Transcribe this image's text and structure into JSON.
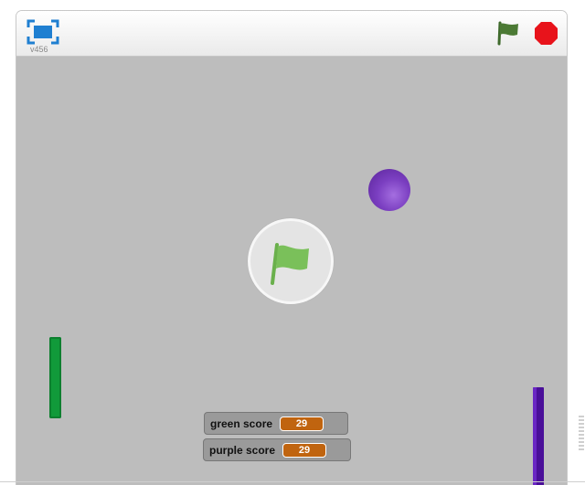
{
  "player": {
    "version_label": "v456"
  },
  "toolbar": {
    "fullscreen_icon": "fullscreen-icon",
    "green_flag_icon": "green-flag-icon",
    "stop_icon": "stop-icon"
  },
  "stage": {
    "background_color": "#bdbdbd",
    "start_overlay_icon": "green-flag-icon"
  },
  "monitors": [
    {
      "label": "green score",
      "value": "29"
    },
    {
      "label": "purple score",
      "value": "29"
    }
  ],
  "colors": {
    "green_paddle": "#119a3a",
    "purple_paddle": "#4a0f99",
    "ball": "#7b3fc1",
    "monitor_value": "#c0640f",
    "stop": "#e8131b",
    "flag": "#4c7a35"
  }
}
